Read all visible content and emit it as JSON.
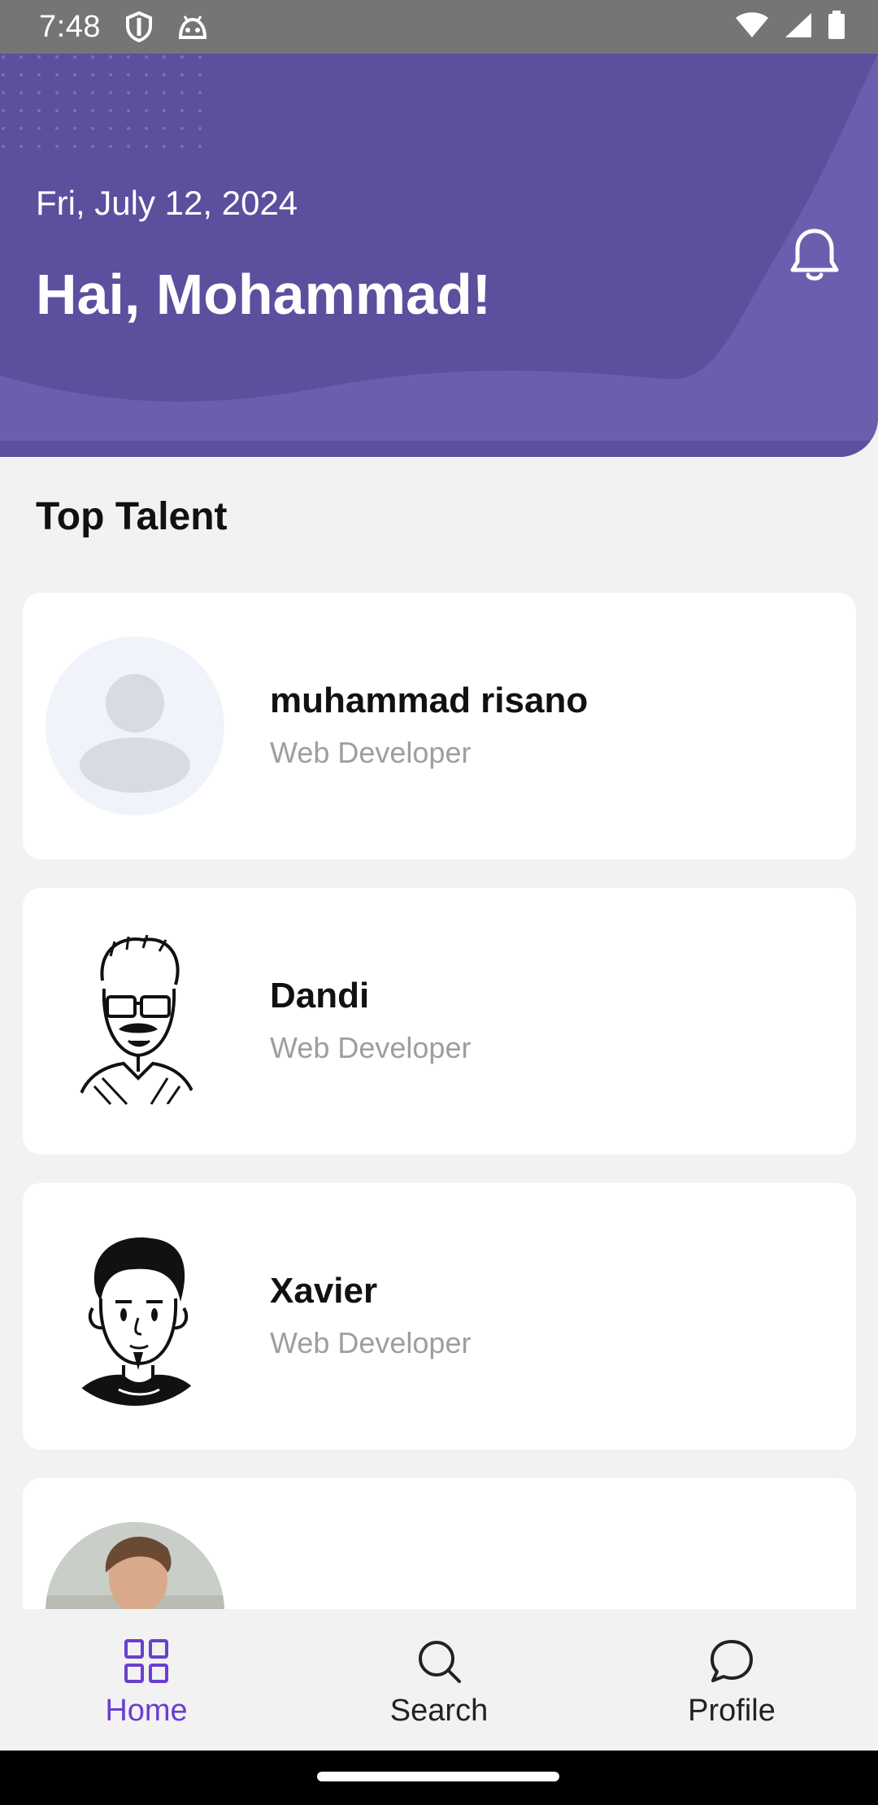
{
  "status_bar": {
    "time": "7:48",
    "icons": [
      "shield-icon",
      "android-icon",
      "wifi-icon",
      "signal-icon",
      "battery-icon"
    ]
  },
  "header": {
    "date": "Fri, July 12, 2024",
    "greeting": "Hai, Mohammad!",
    "icon": "bell-icon"
  },
  "section": {
    "title": "Top Talent"
  },
  "talents": [
    {
      "name": "muhammad risano",
      "role": "Web Developer",
      "avatar": "placeholder-person"
    },
    {
      "name": "Dandi",
      "role": "Web Developer",
      "avatar": "sketch-man-glasses"
    },
    {
      "name": "Xavier",
      "role": "Web Developer",
      "avatar": "sketch-man-goatee"
    },
    {
      "name": "",
      "role": "",
      "avatar": "photo-man"
    }
  ],
  "bottom_nav": {
    "items": [
      {
        "label": "Home",
        "icon": "grid-icon",
        "active": true
      },
      {
        "label": "Search",
        "icon": "search-icon",
        "active": false
      },
      {
        "label": "Profile",
        "icon": "chat-icon",
        "active": false
      }
    ]
  },
  "colors": {
    "header_bg": "#5b4f9e",
    "accent": "#6a3fcf",
    "page_bg": "#f2f2f2",
    "muted_text": "#9e9e9e"
  }
}
